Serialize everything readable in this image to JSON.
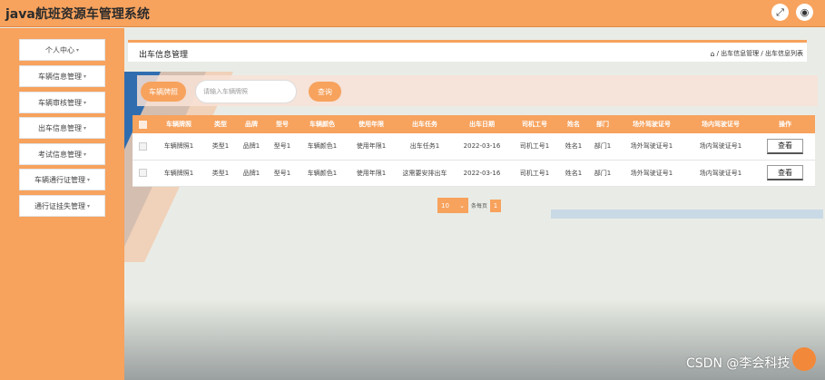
{
  "app": {
    "title": "java航班资源车管理系统"
  },
  "topbar": {
    "fullscreen_icon": "expand-icon",
    "user_icon": "user-icon"
  },
  "sidebar": {
    "items": [
      {
        "label": "个人中心"
      },
      {
        "label": "车辆信息管理"
      },
      {
        "label": "车辆审核管理"
      },
      {
        "label": "出车信息管理"
      },
      {
        "label": "考试信息管理"
      },
      {
        "label": "车辆通行证管理"
      },
      {
        "label": "通行证挂失管理"
      }
    ]
  },
  "header": {
    "title": "出车信息管理",
    "breadcrumb": "/ 出车信息管理 / 出车信息列表"
  },
  "search": {
    "label": "车辆牌照",
    "placeholder": "请输入车辆牌照",
    "button": "查询"
  },
  "table": {
    "columns": [
      "",
      "车辆牌照",
      "类型",
      "品牌",
      "型号",
      "车辆颜色",
      "使用年限",
      "出车任务",
      "出车日期",
      "司机工号",
      "姓名",
      "部门",
      "场外驾驶证号",
      "场内驾驶证号",
      "操作"
    ],
    "rows": [
      {
        "plate": "车辆牌照1",
        "type": "类型1",
        "brand": "品牌1",
        "model": "型号1",
        "color": "车辆颜色1",
        "years": "使用年限1",
        "task": "出车任务1",
        "date": "2022-03-16",
        "driver_id": "司机工号1",
        "name": "姓名1",
        "dept": "部门1",
        "ext_license": "场外驾驶证号1",
        "int_license": "场内驾驶证号1",
        "action": "查看"
      },
      {
        "plate": "车辆牌照1",
        "type": "类型1",
        "brand": "品牌1",
        "model": "型号1",
        "color": "车辆颜色1",
        "years": "使用年限1",
        "task": "这需要安排出车",
        "date": "2022-03-16",
        "driver_id": "司机工号1",
        "name": "姓名1",
        "dept": "部门1",
        "ext_license": "场外驾驶证号1",
        "int_license": "场内驾驶证号1",
        "action": "查看"
      }
    ]
  },
  "pager": {
    "page_size": "10",
    "label": "条每页",
    "page": "1"
  },
  "watermark": "CSDN @李会科技",
  "colors": {
    "accent": "#f7a25d",
    "deco_blue": "#1c5fa8"
  }
}
